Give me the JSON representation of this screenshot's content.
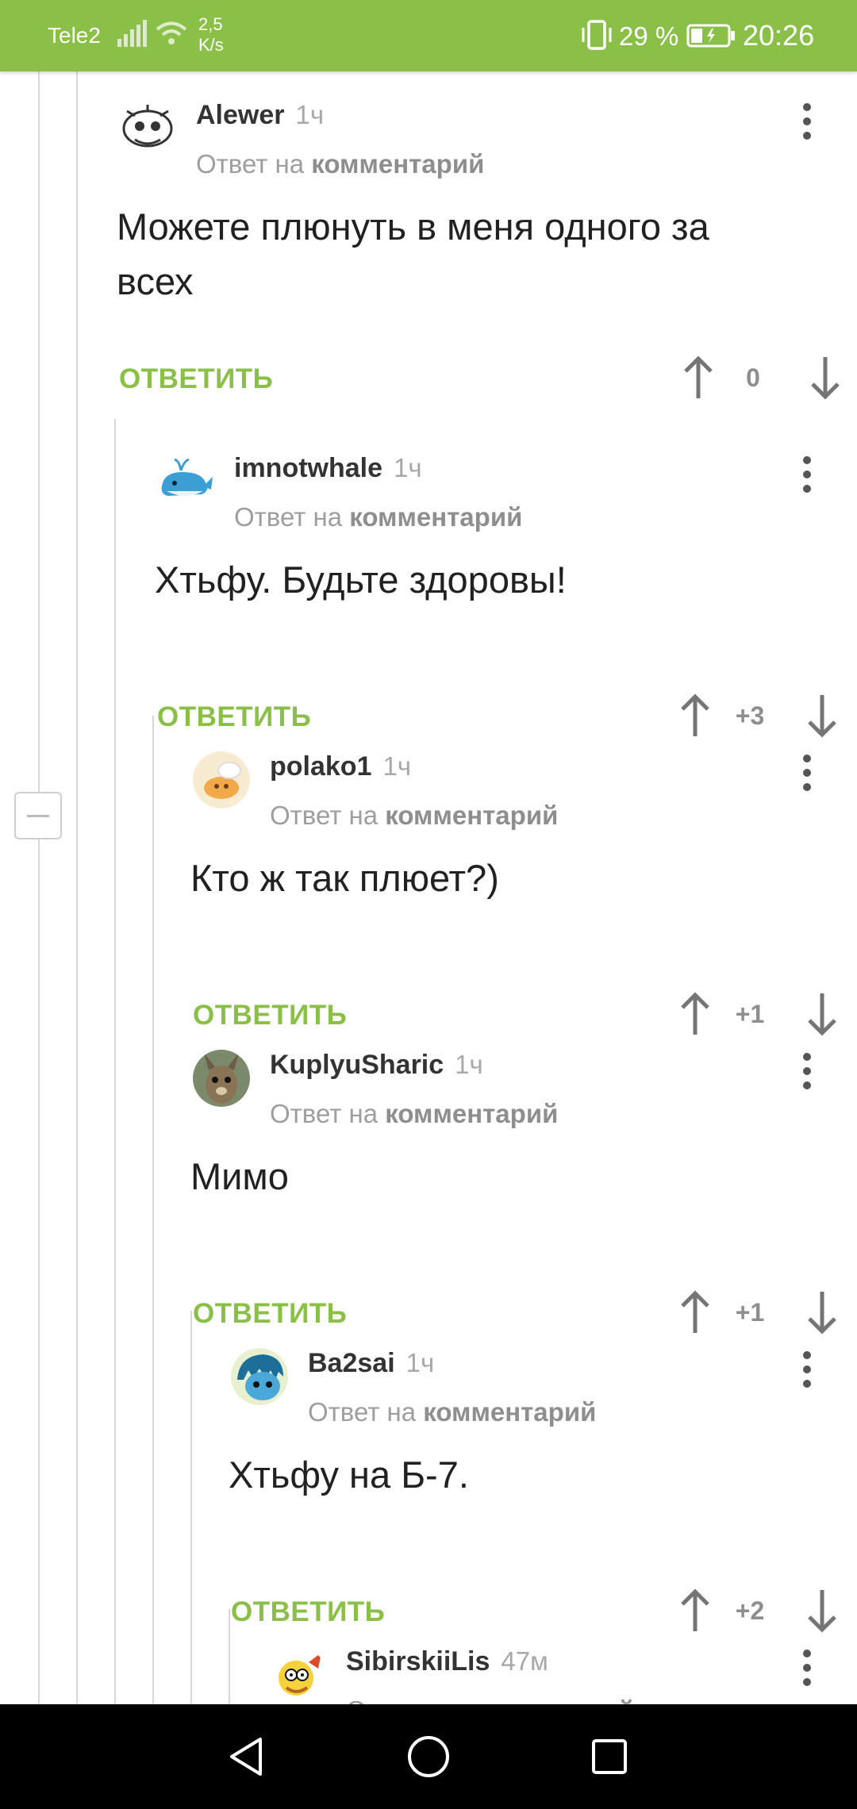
{
  "status_bar": {
    "carrier": "Tele2",
    "speed_value": "2,5",
    "speed_unit": "K/s",
    "battery_percent": "29 %",
    "time": "20:26",
    "icons": [
      "signal-icon",
      "wifi-icon",
      "vibrate-icon",
      "battery-icon"
    ]
  },
  "common": {
    "reply_prefix": "Ответ на",
    "reply_target": "комментарий",
    "reply_label": "ОТВЕТИТЬ"
  },
  "comments": [
    {
      "author": "Alewer",
      "time": "1ч",
      "body": "Можете плюнуть в меня одного за всех",
      "score": "0"
    },
    {
      "author": "imnotwhale",
      "time": "1ч",
      "body": "Хтьфу. Будьте здоровы!",
      "score": "+3"
    },
    {
      "author": "polako1",
      "time": "1ч",
      "body": "Кто ж так плюет?)",
      "score": "+1"
    },
    {
      "author": "KuplyuSharic",
      "time": "1ч",
      "body": "Мимо",
      "score": "+1"
    },
    {
      "author": "Ba2sai",
      "time": "1ч",
      "body": "Хтьфу на Б-7.",
      "score": "+2"
    },
    {
      "author": "SibirskiiLis",
      "time": "47м",
      "body": "",
      "score": ""
    }
  ],
  "colors": {
    "accent": "#8ac047",
    "text": "#212121",
    "muted": "#9e9e9e",
    "nav_bar": "#000000"
  },
  "nav_bar": {
    "icons": [
      "back-icon",
      "home-icon",
      "recents-icon"
    ]
  }
}
